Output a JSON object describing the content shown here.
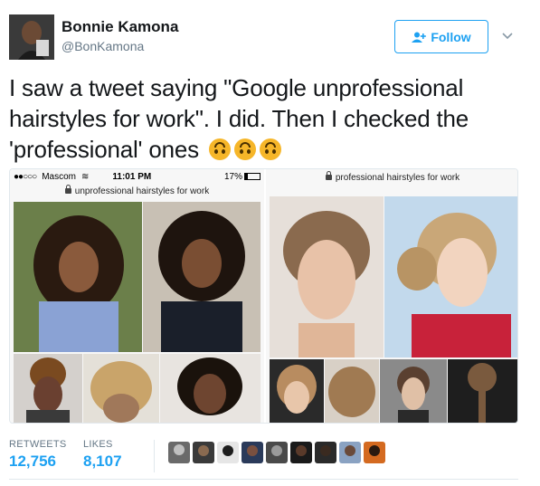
{
  "tweet": {
    "author_name": "Bonnie Kamona",
    "author_handle": "@BonKamona",
    "follow_label": "Follow",
    "text": "I saw a tweet saying \"Google unprofessional hairstyles for work\". I did. Then I checked the 'professional' ones",
    "emoji": [
      "upside-down-face",
      "upside-down-face",
      "upside-down-face"
    ]
  },
  "media": {
    "left_screenshot": {
      "carrier": "Mascom",
      "time": "11:01 PM",
      "battery": "17%",
      "battery_level": 0.17,
      "url": "unprofessional hairstyles for work"
    },
    "right_screenshot": {
      "url": "professional hairstyles for work"
    }
  },
  "stats": {
    "retweets_label": "RETWEETS",
    "retweets_value": "12,756",
    "likes_label": "LIKES",
    "likes_value": "8,107"
  },
  "colors": {
    "accent": "#1da1f2",
    "text": "#14171a",
    "muted": "#657786",
    "border": "#e1e8ed"
  }
}
